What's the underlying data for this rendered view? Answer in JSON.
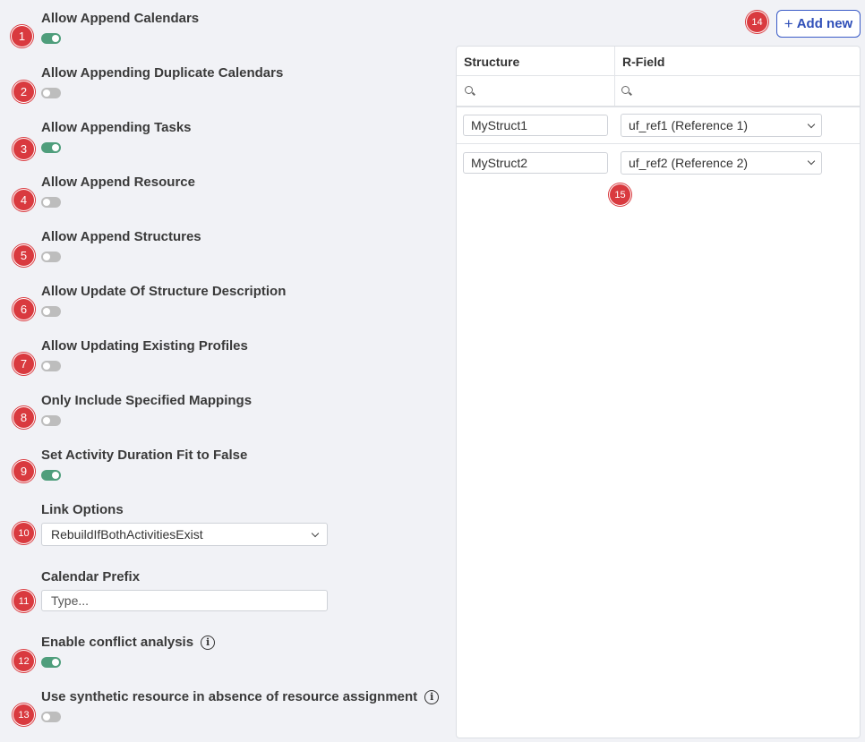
{
  "settings": [
    {
      "label": "Allow Append Calendars",
      "marker": "1",
      "on": true
    },
    {
      "label": "Allow Appending Duplicate Calendars",
      "marker": "2",
      "on": false
    },
    {
      "label": "Allow Appending Tasks",
      "marker": "3",
      "on": true
    },
    {
      "label": "Allow Append Resource",
      "marker": "4",
      "on": false
    },
    {
      "label": "Allow Append Structures",
      "marker": "5",
      "on": false
    },
    {
      "label": "Allow Update Of Structure Description",
      "marker": "6",
      "on": false
    },
    {
      "label": "Allow Updating Existing Profiles",
      "marker": "7",
      "on": false
    },
    {
      "label": "Only Include Specified Mappings",
      "marker": "8",
      "on": false
    },
    {
      "label": "Set Activity Duration Fit to False",
      "marker": "9",
      "on": true
    }
  ],
  "link_options": {
    "label": "Link Options",
    "marker": "10",
    "value": "RebuildIfBothActivitiesExist"
  },
  "calendar_prefix": {
    "label": "Calendar Prefix",
    "marker": "11",
    "placeholder": "Type..."
  },
  "conflict_analysis": {
    "label": "Enable conflict analysis",
    "marker": "12",
    "on": true,
    "info_icon": "i"
  },
  "synthetic_resource": {
    "label": "Use synthetic resource in absence of resource assignment",
    "marker": "13",
    "on": false,
    "info_icon": "i"
  },
  "add_new": {
    "label": "Add new",
    "icon": "+",
    "marker": "14"
  },
  "table": {
    "columns": [
      "Structure",
      "R-Field"
    ],
    "rows": [
      {
        "structure": "MyStruct1",
        "rfield": "uf_ref1 (Reference 1)"
      },
      {
        "structure": "MyStruct2",
        "rfield": "uf_ref2 (Reference 2)"
      }
    ],
    "marker": "15"
  },
  "colors": {
    "toggle_on": "#4f9e7c",
    "toggle_off": "#bdbdbd",
    "marker": "#d93a3f",
    "accent": "#3a5bc7"
  }
}
